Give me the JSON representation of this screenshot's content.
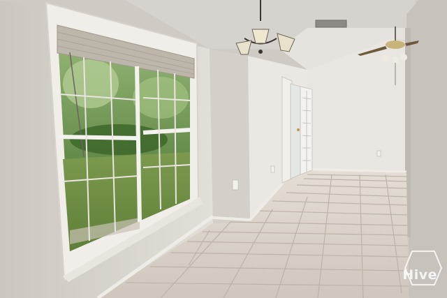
{
  "scene": {
    "description_free": true,
    "watermark": {
      "text": "Hive",
      "color": "#ffffff"
    },
    "palette": {
      "wall_light": "#e7e3de",
      "wall_shade": "#c9c4be",
      "ceiling": "#d9d6d2",
      "floor_tile": "#d8d1c8",
      "grout": "#b9b0a5",
      "grass": "#6f8f46",
      "foliage": "#4f7a33",
      "window_frame": "#f0ede8"
    },
    "icons": [
      "chandelier-icon",
      "ceiling-fan-icon",
      "hive-logo-icon"
    ]
  }
}
